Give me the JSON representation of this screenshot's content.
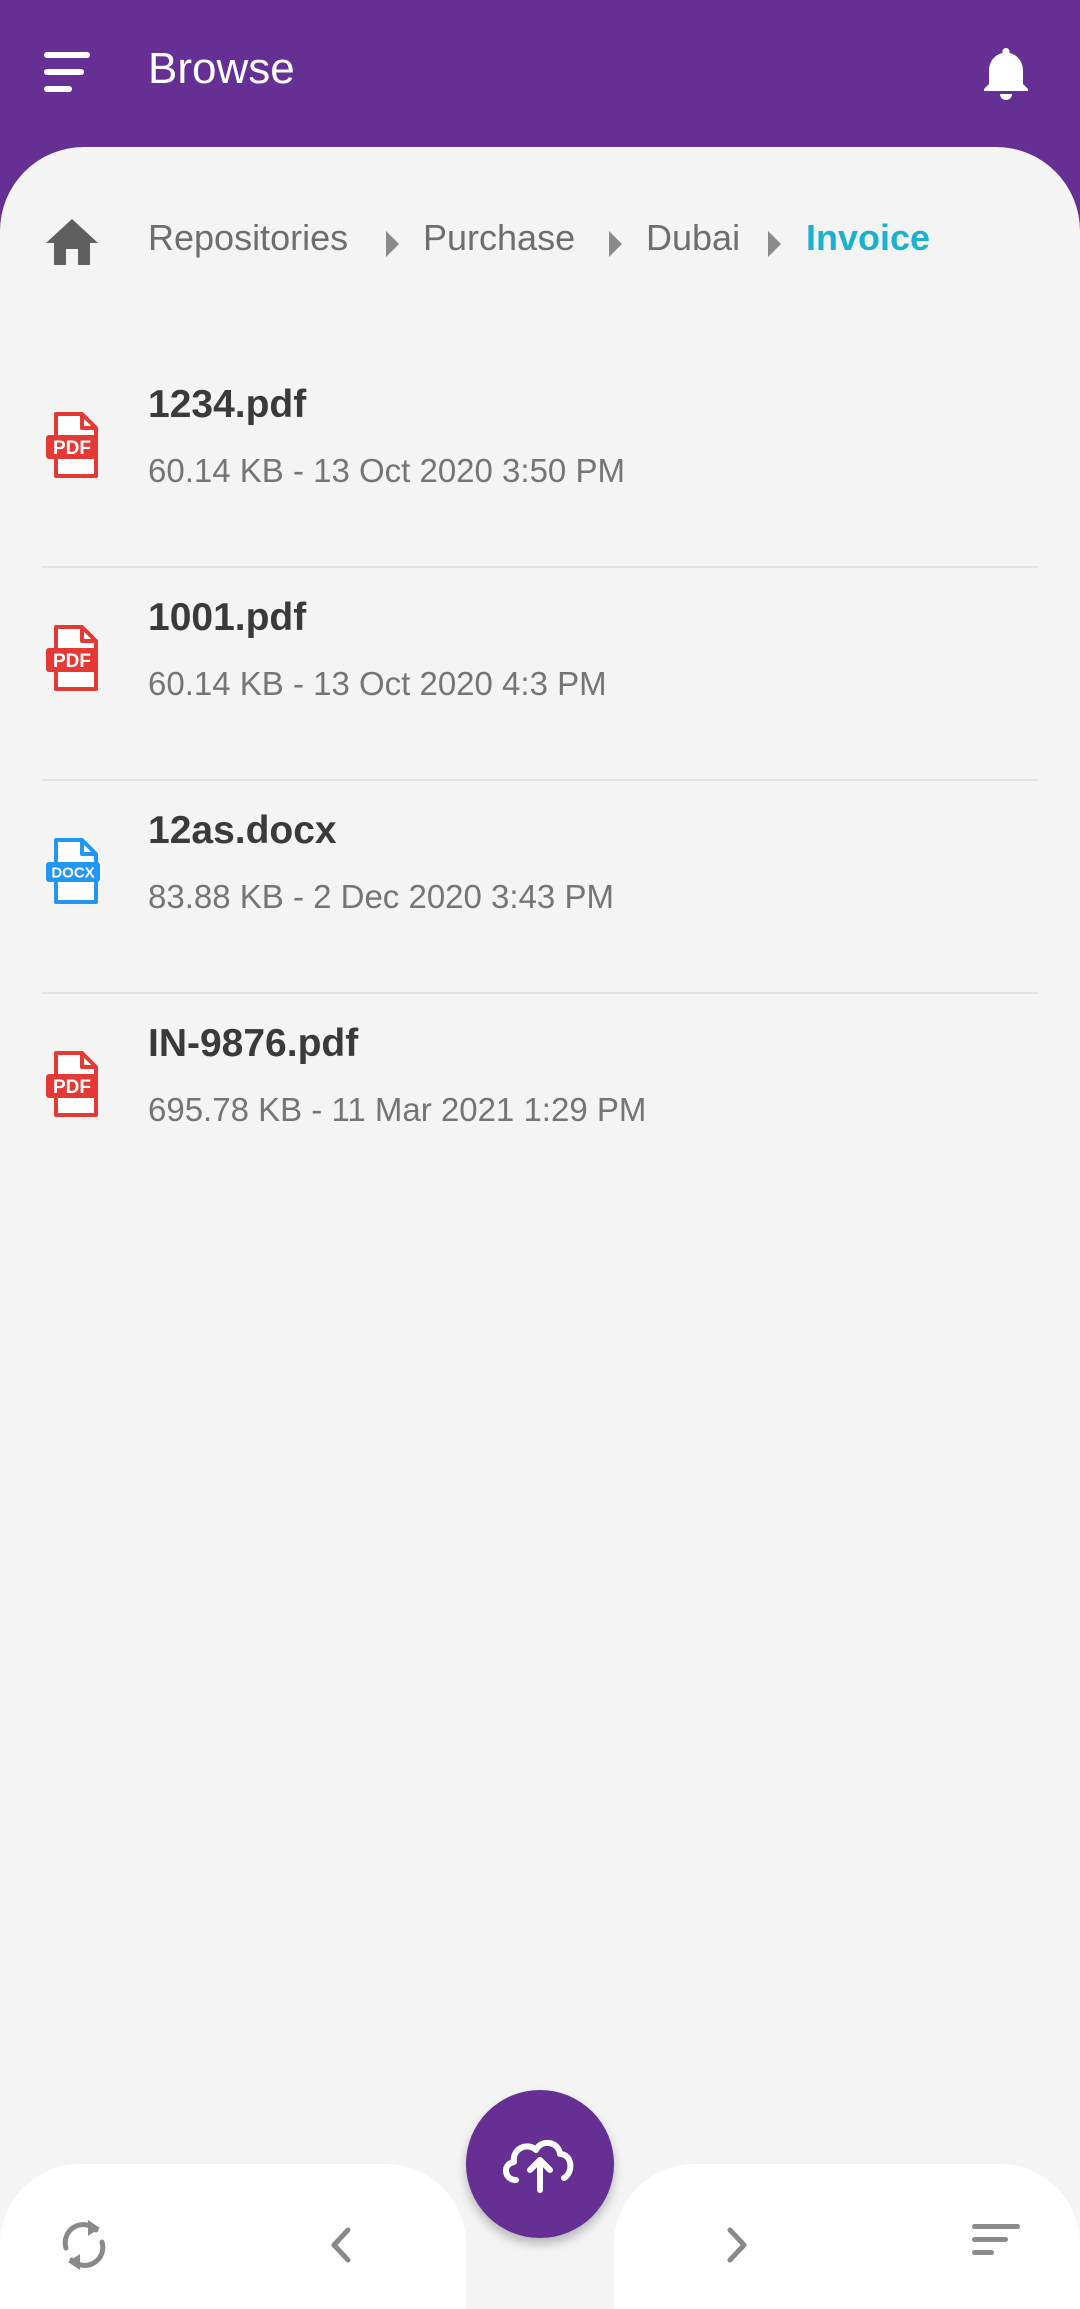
{
  "header": {
    "title": "Browse",
    "menu_icon": "menu-icon",
    "bell_icon": "bell-icon"
  },
  "colors": {
    "primary": "#652F93",
    "accent": "#1CB2CF",
    "pdf": "#E53935",
    "docx": "#2196F3",
    "background": "#F4F4F4"
  },
  "breadcrumb": {
    "home_icon": "home-icon",
    "items": [
      {
        "label": "Repositories"
      },
      {
        "label": "Purchase"
      },
      {
        "label": "Dubai"
      },
      {
        "label": "Invoice",
        "active": true
      }
    ]
  },
  "files": [
    {
      "name": "1234.pdf",
      "meta": "60.14 KB - 13 Oct 2020 3:50 PM",
      "type": "PDF",
      "icon": "pdf-file-icon"
    },
    {
      "name": "1001.pdf",
      "meta": "60.14 KB - 13 Oct 2020 4:3 PM",
      "type": "PDF",
      "icon": "pdf-file-icon"
    },
    {
      "name": "12as.docx",
      "meta": "83.88 KB - 2 Dec 2020 3:43 PM",
      "type": "DOCX",
      "icon": "docx-file-icon"
    },
    {
      "name": "IN-9876.pdf",
      "meta": "695.78 KB - 11 Mar 2021 1:29 PM",
      "type": "PDF",
      "icon": "pdf-file-icon"
    }
  ],
  "bottom_bar": {
    "refresh_icon": "refresh-icon",
    "back_icon": "chevron-left-icon",
    "upload_icon": "cloud-upload-icon",
    "forward_icon": "chevron-right-icon",
    "sort_icon": "sort-icon"
  }
}
